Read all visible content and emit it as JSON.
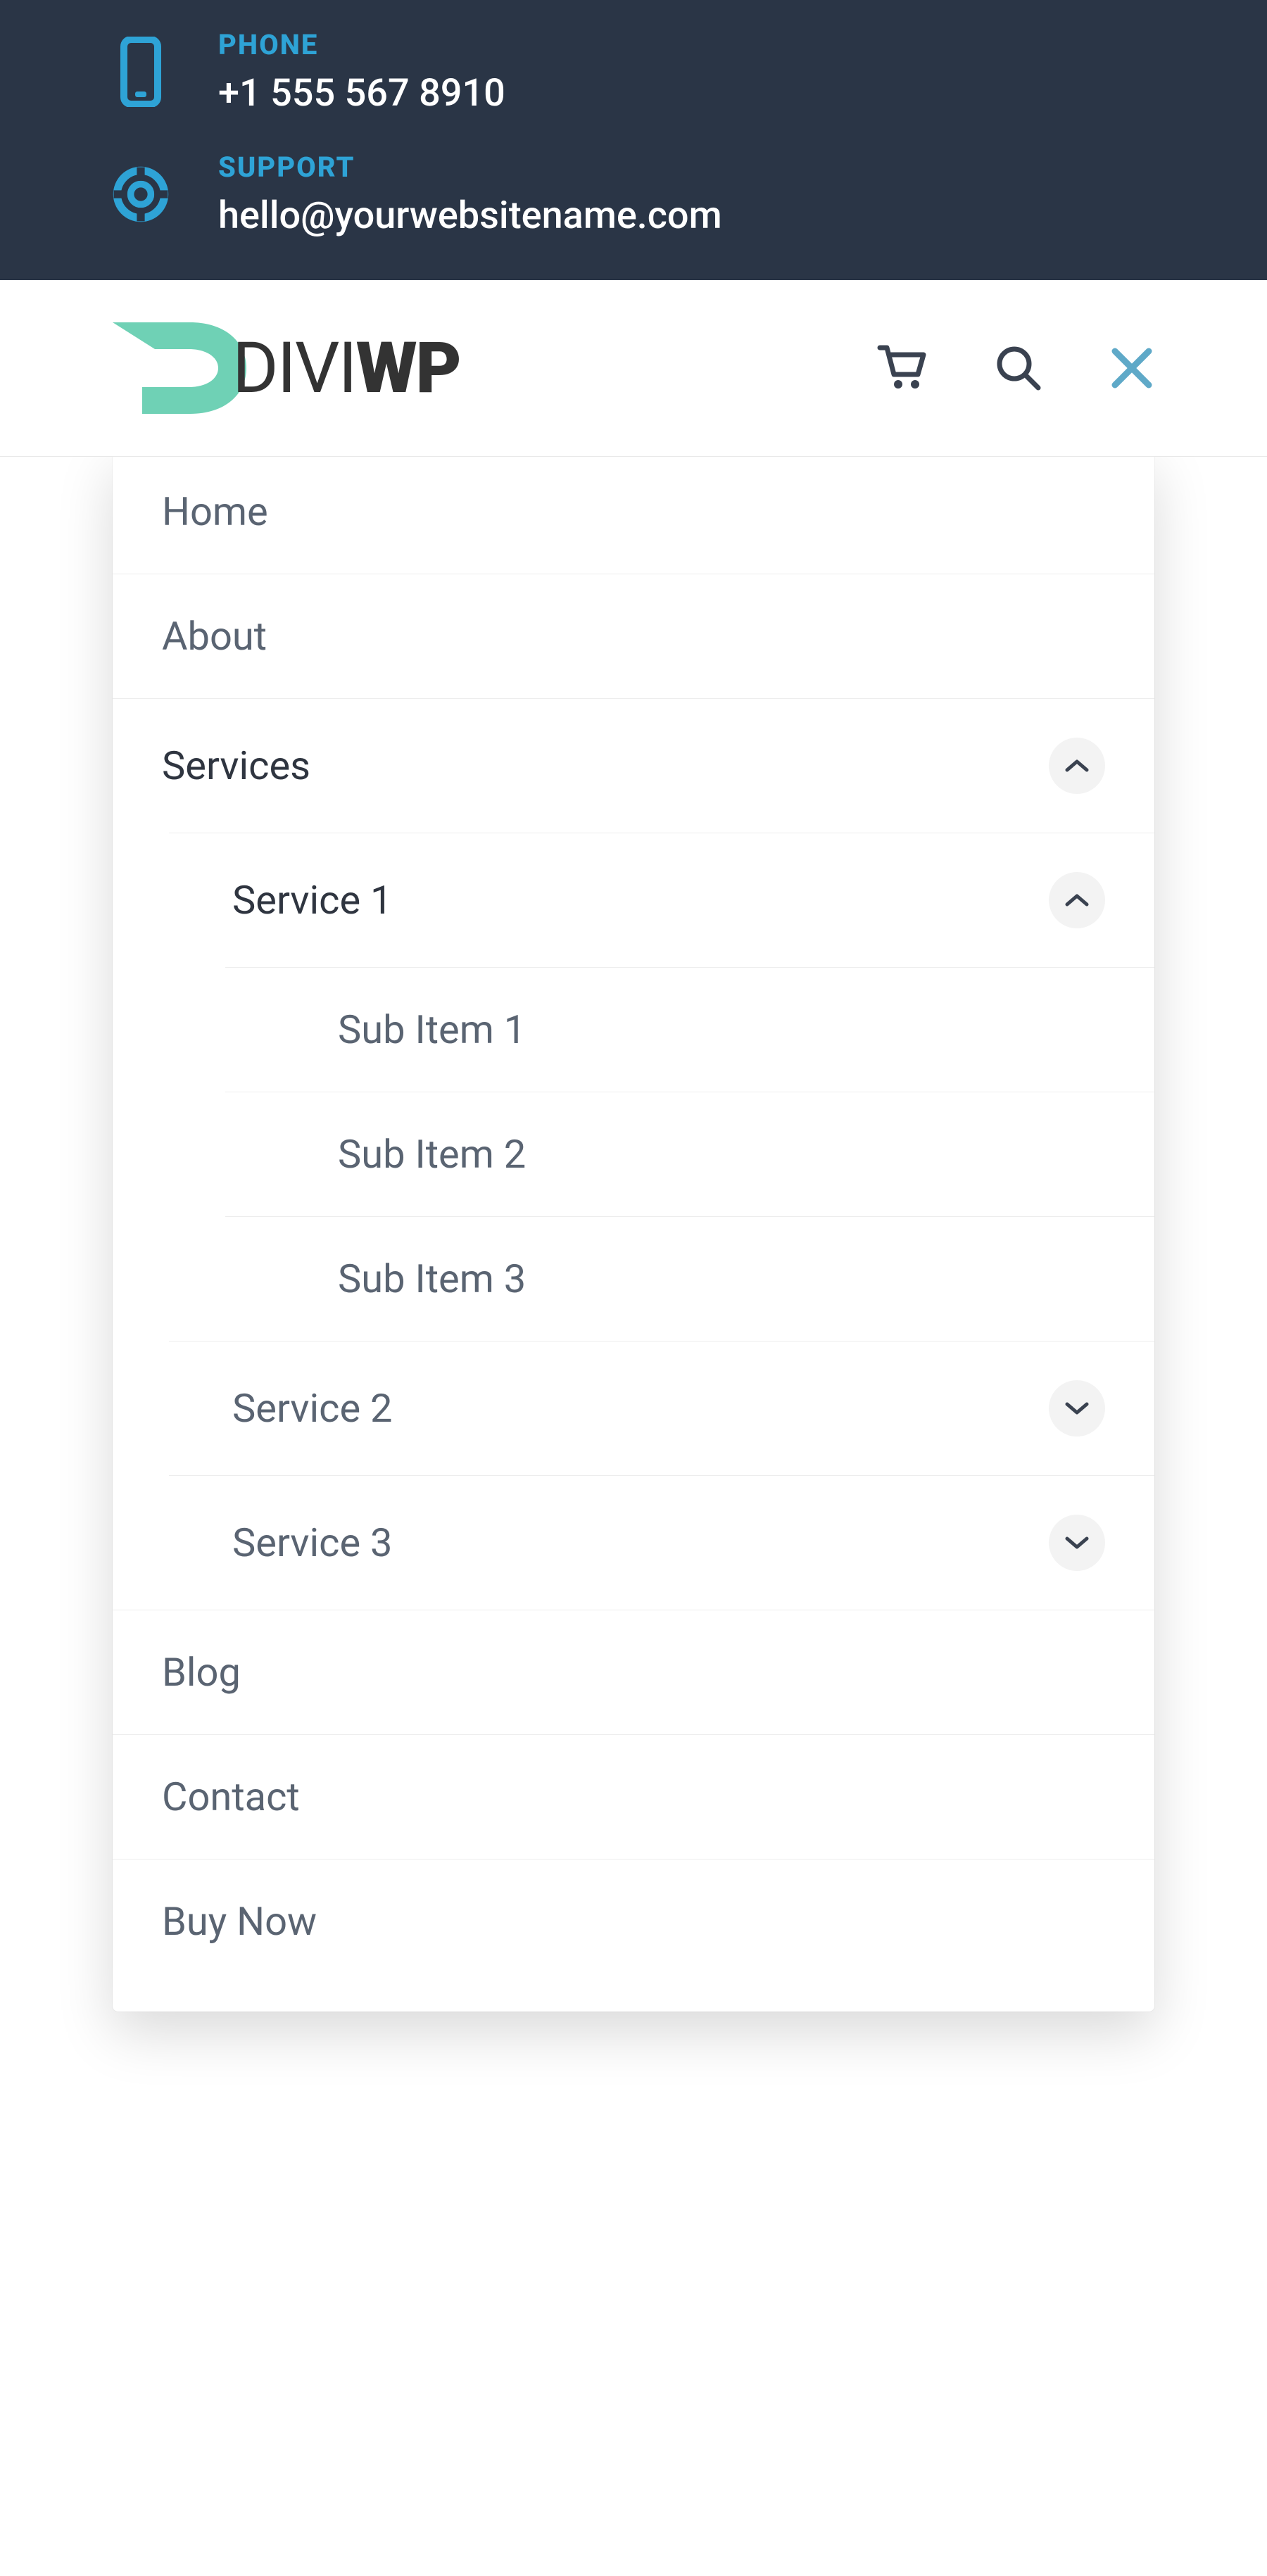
{
  "topbar": {
    "phone": {
      "label": "PHONE",
      "value": "+1 555 567 8910"
    },
    "support": {
      "label": "SUPPORT",
      "value": "hello@yourwebsitename.com"
    }
  },
  "logo": {
    "text1": "DIVI",
    "text2": "WP"
  },
  "menu": {
    "home": "Home",
    "about": "About",
    "services": "Services",
    "service1": "Service 1",
    "sub1": "Sub Item 1",
    "sub2": "Sub Item 2",
    "sub3": "Sub Item 3",
    "service2": "Service 2",
    "service3": "Service 3",
    "blog": "Blog",
    "contact": "Contact",
    "buy": "Buy Now"
  }
}
